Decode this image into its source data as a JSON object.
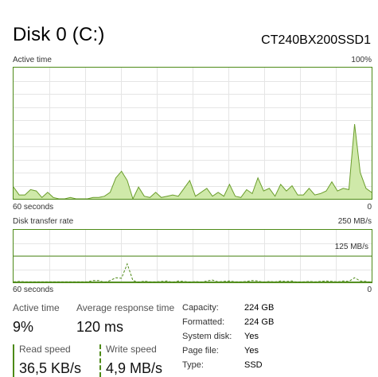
{
  "header": {
    "title": "Disk 0 (C:)",
    "model": "CT240BX200SSD1"
  },
  "active_chart": {
    "label": "Active time",
    "max_label": "100%",
    "time_label": "60 seconds",
    "min_label": "0",
    "values": [
      9,
      3,
      3,
      7,
      6,
      1,
      5,
      1,
      0,
      0,
      1,
      0,
      0,
      0,
      1,
      1,
      2,
      5,
      16,
      21,
      14,
      0,
      9,
      2,
      1,
      5,
      1,
      2,
      3,
      2,
      8,
      14,
      2,
      5,
      8,
      2,
      5,
      2,
      11,
      2,
      1,
      7,
      4,
      16,
      6,
      8,
      2,
      11,
      6,
      10,
      3,
      3,
      8,
      3,
      4,
      6,
      13,
      6,
      8,
      7,
      57,
      20,
      8,
      5
    ],
    "color": "#6a9d2c",
    "fill": "#cfe9a9"
  },
  "transfer_chart": {
    "label": "Disk transfer rate",
    "max_label": "250 MB/s",
    "mid_label": "125 MB/s",
    "time_label": "60 seconds",
    "min_label": "0",
    "read_values": [
      1,
      1,
      1,
      1,
      1,
      1,
      1,
      1,
      1,
      1,
      1,
      1,
      1,
      1,
      1,
      1,
      1,
      1,
      1,
      1,
      1,
      1,
      1,
      1,
      1,
      1,
      1,
      1,
      1,
      1,
      1,
      1,
      1,
      1,
      1,
      1,
      1,
      1,
      1,
      1,
      1,
      1,
      1,
      1,
      1,
      1,
      1,
      1,
      1,
      1,
      1,
      1,
      1,
      1,
      1,
      1,
      1,
      1,
      1,
      1,
      1,
      1,
      1,
      1
    ],
    "write_values": [
      1,
      2,
      1,
      1,
      1,
      1,
      1,
      1,
      1,
      1,
      1,
      1,
      1,
      1,
      4,
      4,
      0,
      4,
      10,
      9,
      0,
      4,
      0,
      3,
      1,
      1,
      2,
      3,
      0,
      3,
      2,
      0,
      2,
      0,
      3,
      5,
      1,
      2,
      3,
      1,
      1,
      2,
      4,
      3,
      0,
      2,
      1,
      3,
      2,
      3,
      0,
      1,
      2,
      1,
      2,
      3,
      2,
      1,
      3,
      2,
      10,
      3,
      2,
      0
    ],
    "write_peak_index": 20,
    "write_peak_value": 40,
    "color": "#4d8a17"
  },
  "stats": {
    "active_time_label": "Active time",
    "active_time_value": "9%",
    "avg_response_label": "Average response time",
    "avg_response_value": "120 ms",
    "read_speed_label": "Read speed",
    "read_speed_value": "36,5 KB/s",
    "write_speed_label": "Write speed",
    "write_speed_value": "4,9 MB/s"
  },
  "properties": [
    {
      "label": "Capacity:",
      "value": "224 GB"
    },
    {
      "label": "Formatted:",
      "value": "224 GB"
    },
    {
      "label": "System disk:",
      "value": "Yes"
    },
    {
      "label": "Page file:",
      "value": "Yes"
    },
    {
      "label": "Type:",
      "value": "SSD"
    }
  ]
}
